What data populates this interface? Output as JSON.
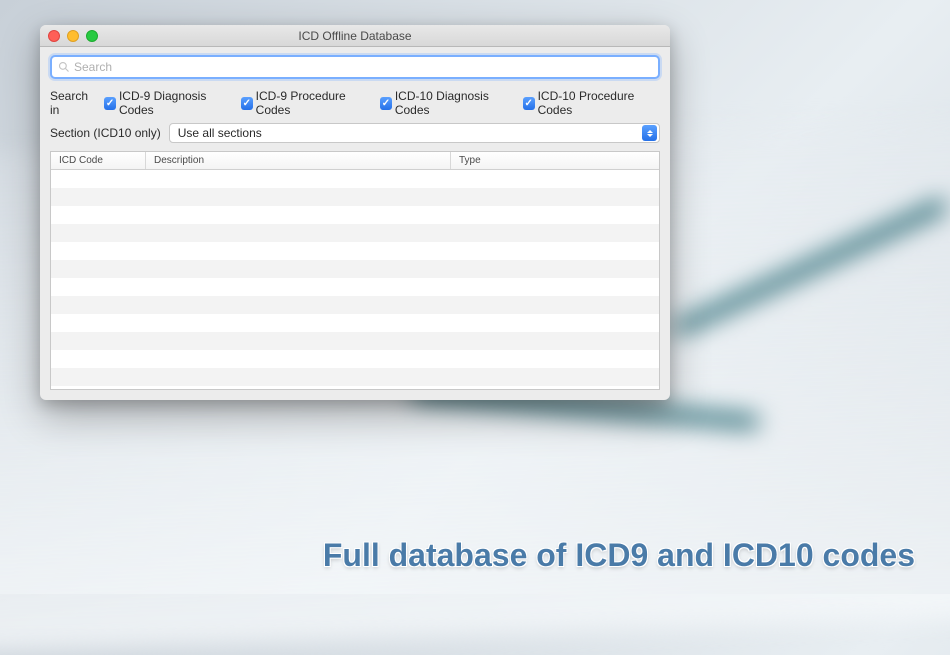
{
  "window": {
    "title": "ICD Offline Database"
  },
  "search": {
    "placeholder": "Search",
    "value": ""
  },
  "filters": {
    "label": "Search in",
    "options": [
      {
        "label": "ICD-9 Diagnosis Codes",
        "checked": true
      },
      {
        "label": "ICD-9 Procedure Codes",
        "checked": true
      },
      {
        "label": "ICD-10 Diagnosis Codes",
        "checked": true
      },
      {
        "label": "ICD-10 Procedure Codes",
        "checked": true
      }
    ]
  },
  "section": {
    "label": "Section (ICD10 only)",
    "selected": "Use all sections"
  },
  "table": {
    "columns": {
      "code": "ICD Code",
      "description": "Description",
      "type": "Type"
    }
  },
  "caption": "Full database of ICD9 and ICD10 codes"
}
